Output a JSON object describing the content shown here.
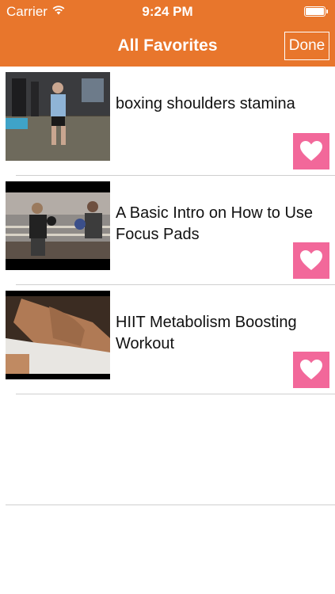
{
  "status": {
    "carrier": "Carrier",
    "time": "9:24 PM"
  },
  "nav": {
    "title": "All Favorites",
    "done_label": "Done"
  },
  "favorites": [
    {
      "title": "boxing shoulders stamina"
    },
    {
      "title": "A Basic Intro on How to Use Focus Pads"
    },
    {
      "title": "HIIT Metabolism Boosting Workout"
    }
  ],
  "colors": {
    "header": "#e8762c",
    "heart_button": "#f2689a"
  },
  "icons": {
    "favorite": "heart-icon",
    "wifi": "wifi-icon",
    "battery": "battery-icon"
  }
}
